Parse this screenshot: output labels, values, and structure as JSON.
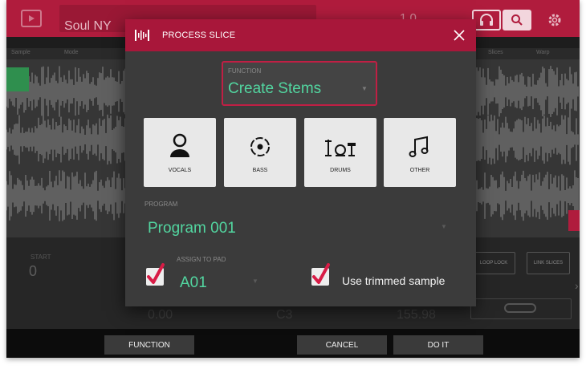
{
  "app": {
    "sample_name": "Soul NY",
    "tempo_readout": "1.0",
    "sub_labels": [
      "Sample",
      "Mode",
      "Slices",
      "Warp"
    ]
  },
  "parameters": {
    "start_label": "START",
    "start_value": "0",
    "loop_lock_label": "LOOP LOCK",
    "link_slices_label": "LINK SLICES",
    "row_values": [
      "0.00",
      "C3",
      "155.98"
    ]
  },
  "dialog": {
    "title": "PROCESS SLICE",
    "function": {
      "label": "FUNCTION",
      "value": "Create Stems"
    },
    "stems": [
      {
        "label": "VOCALS",
        "icon": "vocals-icon"
      },
      {
        "label": "BASS",
        "icon": "bass-icon"
      },
      {
        "label": "DRUMS",
        "icon": "drums-icon"
      },
      {
        "label": "OTHER",
        "icon": "other-icon"
      }
    ],
    "program": {
      "label": "PROGRAM",
      "value": "Program 001"
    },
    "assign_to_pad": {
      "label": "ASSIGN TO PAD",
      "value": "A01",
      "checked": true
    },
    "use_trimmed_sample": {
      "label": "Use trimmed sample",
      "checked": true
    }
  },
  "bottom_bar": {
    "function_label": "FUNCTION",
    "cancel_label": "CANCEL",
    "do_it_label": "DO IT"
  },
  "colors": {
    "accent_red": "#a8173a",
    "value_green": "#52d6a0",
    "dialog_bg": "#3b3b3b"
  }
}
